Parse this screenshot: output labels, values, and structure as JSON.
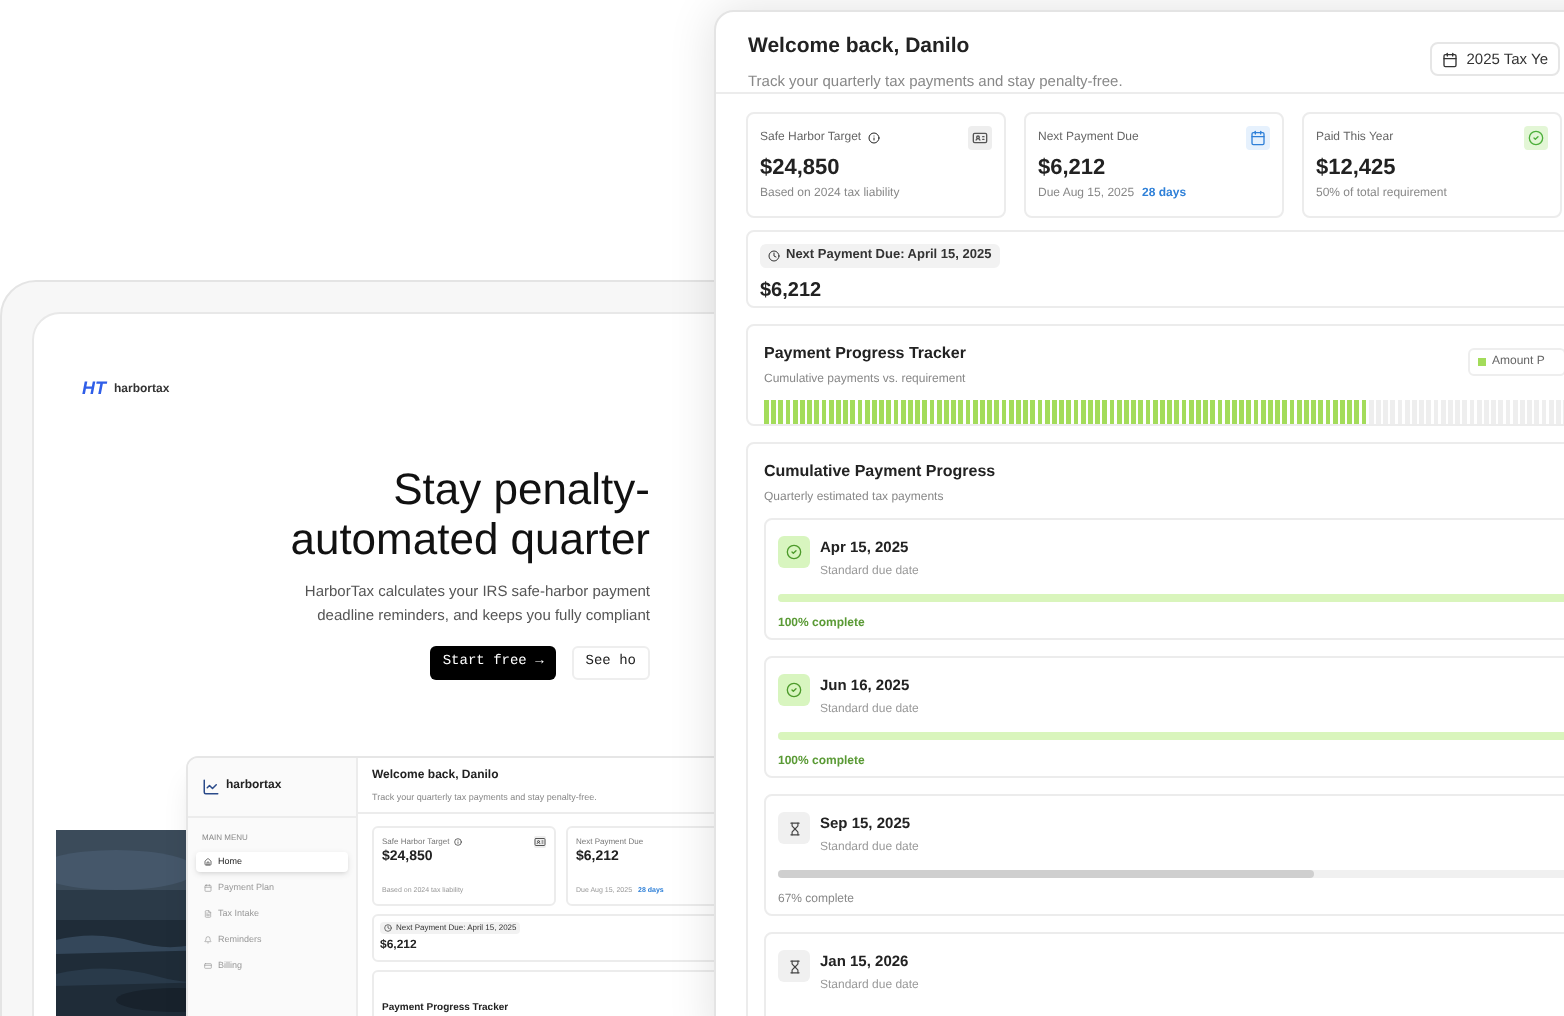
{
  "landing": {
    "logo_mark": "HT",
    "logo_text": "harbortax",
    "headline": [
      "Stay penalty-",
      "automated quarter"
    ],
    "description": [
      "HarborTax calculates your IRS safe-harbor payment",
      "deadline reminders, and keeps you fully compliant"
    ],
    "buttons": [
      {
        "label": "Start free →",
        "kind": "primary"
      },
      {
        "label": "See ho",
        "kind": "secondary"
      }
    ]
  },
  "small_dashboard": {
    "logo_text": "harbortax",
    "menu_heading": "MAIN MENU",
    "menu": [
      {
        "label": "Home",
        "selected": true
      },
      {
        "label": "Payment Plan",
        "selected": false
      },
      {
        "label": "Tax Intake",
        "selected": false
      },
      {
        "label": "Reminders",
        "selected": false
      },
      {
        "label": "Billing",
        "selected": false
      }
    ],
    "welcome": "Welcome back, Danilo",
    "subtitle": "Track your quarterly tax payments and stay penalty-free.",
    "cards": [
      {
        "label": "Safe Harbor Target",
        "info": true,
        "value": "$24,850",
        "note": "Based on 2024 tax liability"
      },
      {
        "label": "Next Payment Due",
        "info": false,
        "value": "$6,212",
        "note": "Due Aug 15, 2025",
        "highlight": "28 days"
      }
    ],
    "next_payment": {
      "label": "Next Payment Due: April 15, 2025",
      "amount": "$6,212"
    },
    "tracker_title": "Payment Progress Tracker"
  },
  "dashboard": {
    "welcome": "Welcome back, Danilo",
    "subtitle": "Track your quarterly tax payments and stay penalty-free.",
    "year_button": "2025 Tax Ye",
    "cards": [
      {
        "label": "Safe Harbor Target",
        "info": true,
        "value": "$24,850",
        "note": "Based on 2024 tax liability"
      },
      {
        "label": "Next Payment Due",
        "info": false,
        "value": "$6,212",
        "note": "Due Aug 15, 2025",
        "highlight": "28 days"
      },
      {
        "label": "Paid This Year",
        "info": false,
        "value": "$12,425",
        "note": "50% of total requirement"
      }
    ],
    "next_payment": {
      "label": "Next Payment Due: April 15, 2025",
      "amount": "$6,212"
    },
    "tracker": {
      "title": "Payment Progress Tracker",
      "subtitle": "Cumulative payments vs. requirement",
      "legend": "Amount P",
      "level": 0.72
    },
    "progress": {
      "title": "Cumulative Payment Progress",
      "subtitle": "Quarterly estimated tax payments",
      "payments": [
        {
          "date": "Apr 15, 2025",
          "note": "Standard due date",
          "completed": true,
          "level": 1,
          "caption": "100% complete"
        },
        {
          "date": "Jun 16, 2025",
          "note": "Standard due date",
          "completed": true,
          "level": 1,
          "caption": "100% complete"
        },
        {
          "date": "Sep 15, 2025",
          "note": "Standard due date",
          "completed": false,
          "level": 0.67,
          "caption": "67% complete"
        },
        {
          "date": "Jan 15, 2026",
          "note": "Standard due date",
          "completed": false
        }
      ]
    }
  }
}
